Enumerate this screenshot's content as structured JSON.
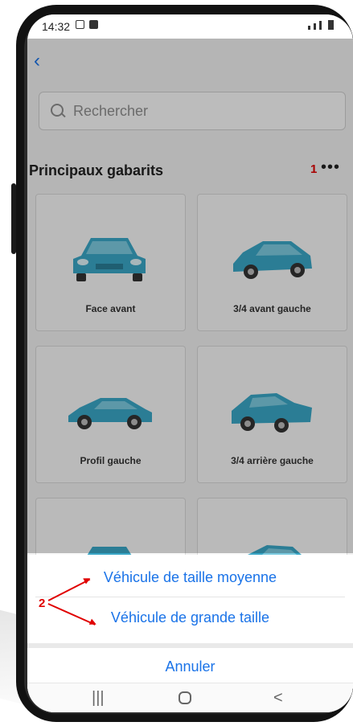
{
  "status": {
    "time": "14:32"
  },
  "header": {
    "back_icon": "chevron-left-icon"
  },
  "search": {
    "placeholder": "Rechercher"
  },
  "section": {
    "title": "Principaux gabarits",
    "more_label": "•••"
  },
  "annotations": {
    "one": "1",
    "two": "2"
  },
  "cards": [
    {
      "label": "Face avant"
    },
    {
      "label": "3/4 avant gauche"
    },
    {
      "label": "Profil gauche"
    },
    {
      "label": "3/4 arrière gauche"
    },
    {
      "label": ""
    },
    {
      "label": ""
    }
  ],
  "sheet": {
    "options": [
      "Véhicule de taille moyenne",
      "Véhicule de grande taille"
    ],
    "cancel": "Annuler"
  },
  "navbar": {
    "recent": "|||",
    "back": "<"
  },
  "colors": {
    "accent": "#1a73e8",
    "car": "#3aa7c7",
    "annotation": "#e00000"
  }
}
